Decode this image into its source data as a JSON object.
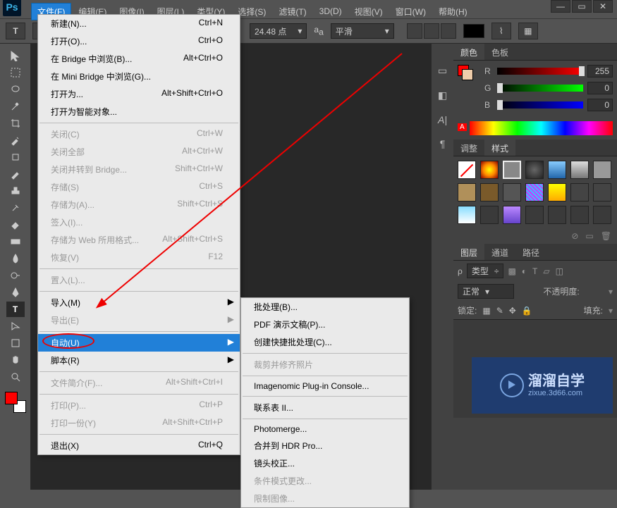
{
  "app": {
    "logo": "Ps"
  },
  "menubar": {
    "file": "文件(F)",
    "edit": "编辑(E)",
    "image": "图像(I)",
    "layer": "图层(L)",
    "type": "类型(Y)",
    "select": "选择(S)",
    "filter": "滤镜(T)",
    "threeD": "3D(D)",
    "view": "视图(V)",
    "window": "窗口(W)",
    "help": "帮助(H)"
  },
  "options": {
    "font_size": "24.48 点",
    "aa_label": "平滑"
  },
  "file_menu": [
    {
      "label": "新建(N)...",
      "accel": "Ctrl+N"
    },
    {
      "label": "打开(O)...",
      "accel": "Ctrl+O"
    },
    {
      "label": "在 Bridge 中浏览(B)...",
      "accel": "Alt+Ctrl+O"
    },
    {
      "label": "在 Mini Bridge 中浏览(G)..."
    },
    {
      "label": "打开为...",
      "accel": "Alt+Shift+Ctrl+O"
    },
    {
      "label": "打开为智能对象..."
    },
    {
      "sep": true
    },
    {
      "label": "关闭(C)",
      "accel": "Ctrl+W",
      "disabled": true
    },
    {
      "label": "关闭全部",
      "accel": "Alt+Ctrl+W",
      "disabled": true
    },
    {
      "label": "关闭并转到 Bridge...",
      "accel": "Shift+Ctrl+W",
      "disabled": true
    },
    {
      "label": "存储(S)",
      "accel": "Ctrl+S",
      "disabled": true
    },
    {
      "label": "存储为(A)...",
      "accel": "Shift+Ctrl+S",
      "disabled": true
    },
    {
      "label": "签入(I)...",
      "disabled": true
    },
    {
      "label": "存储为 Web 所用格式...",
      "accel": "Alt+Shift+Ctrl+S",
      "disabled": true
    },
    {
      "label": "恢复(V)",
      "accel": "F12",
      "disabled": true
    },
    {
      "sep": true
    },
    {
      "label": "置入(L)...",
      "disabled": true
    },
    {
      "sep": true
    },
    {
      "label": "导入(M)",
      "sub": true
    },
    {
      "label": "导出(E)",
      "sub": true,
      "disabled": true
    },
    {
      "sep": true
    },
    {
      "label": "自动(U)",
      "sub": true,
      "hl": true,
      "ellipse": true
    },
    {
      "label": "脚本(R)",
      "sub": true
    },
    {
      "sep": true
    },
    {
      "label": "文件简介(F)...",
      "accel": "Alt+Shift+Ctrl+I",
      "disabled": true
    },
    {
      "sep": true
    },
    {
      "label": "打印(P)...",
      "accel": "Ctrl+P",
      "disabled": true
    },
    {
      "label": "打印一份(Y)",
      "accel": "Alt+Shift+Ctrl+P",
      "disabled": true
    },
    {
      "sep": true
    },
    {
      "label": "退出(X)",
      "accel": "Ctrl+Q"
    }
  ],
  "auto_menu": [
    {
      "label": "批处理(B)..."
    },
    {
      "label": "PDF 演示文稿(P)..."
    },
    {
      "label": "创建快捷批处理(C)..."
    },
    {
      "sep": true
    },
    {
      "label": "裁剪并修齐照片",
      "disabled": true
    },
    {
      "sep": true
    },
    {
      "label": "Imagenomic Plug-in Console..."
    },
    {
      "sep": true
    },
    {
      "label": "联系表 II..."
    },
    {
      "sep": true
    },
    {
      "label": "Photomerge..."
    },
    {
      "label": "合并到 HDR Pro..."
    },
    {
      "label": "镜头校正..."
    },
    {
      "label": "条件模式更改...",
      "disabled": true
    },
    {
      "label": "限制图像...",
      "disabled": true
    }
  ],
  "panels": {
    "color_tab": "颜色",
    "swatch_tab": "色板",
    "adjust_tab": "调整",
    "style_tab": "样式",
    "layers_tab": "图层",
    "channels_tab": "通道",
    "paths_tab": "路径",
    "r": "R",
    "g": "G",
    "b": "B",
    "r_val": "255",
    "g_val": "0",
    "b_val": "0",
    "kind": "类型",
    "normal": "正常",
    "opacity": "不透明度:",
    "lock_label": "锁定:",
    "fill_label": "填充:"
  },
  "watermark": {
    "main": "溜溜自学",
    "sub": "zixue.3d66.com"
  }
}
